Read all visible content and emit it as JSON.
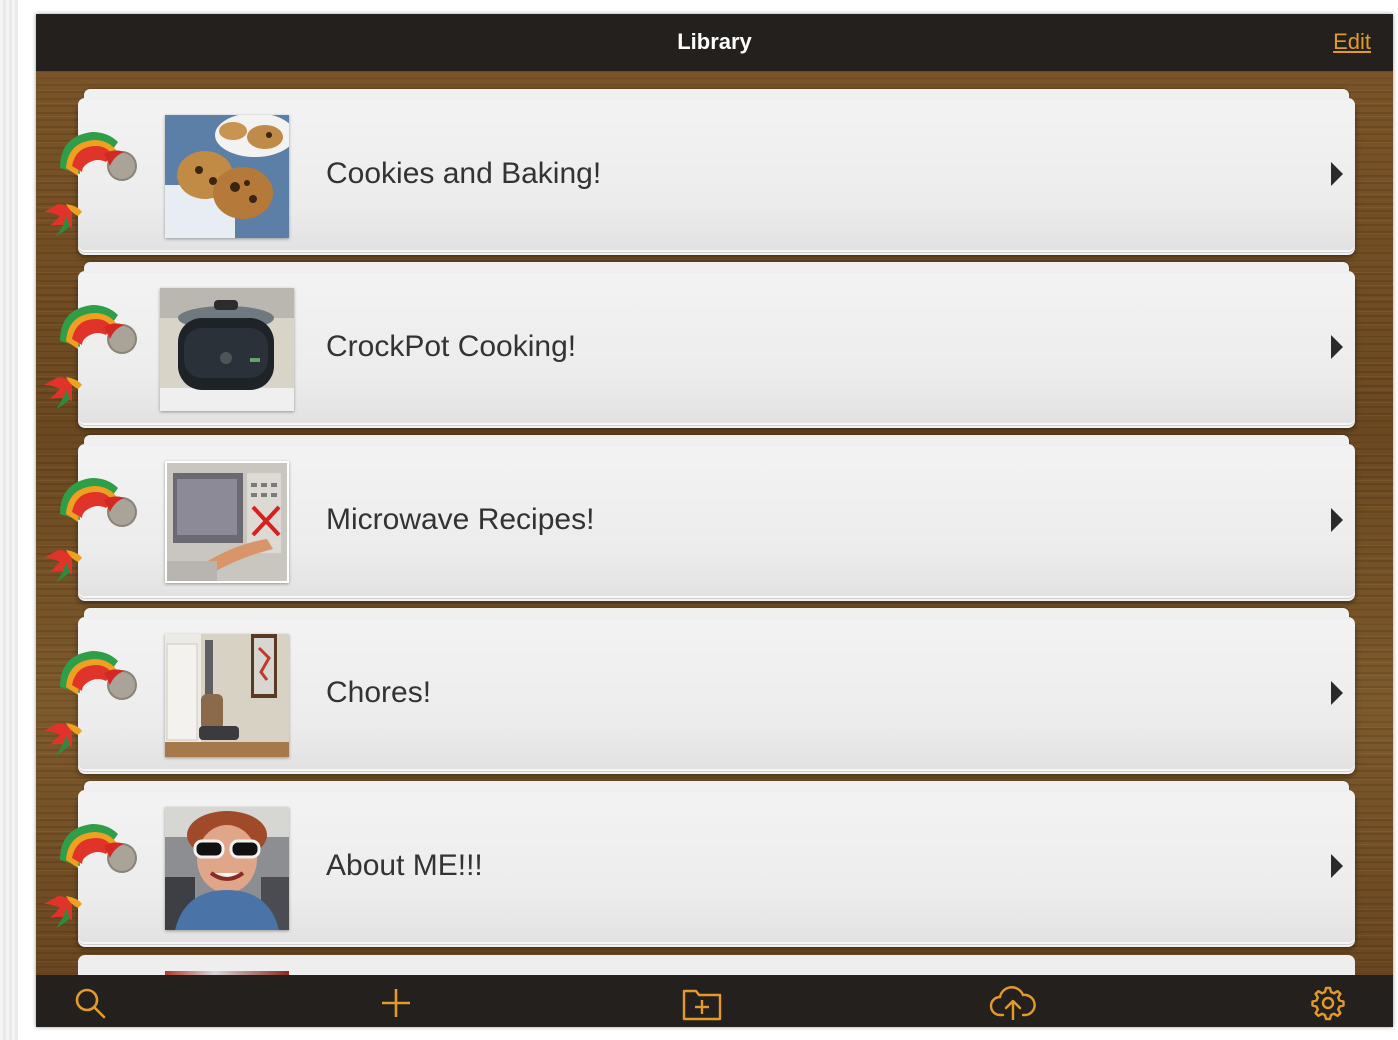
{
  "navbar": {
    "title": "Library",
    "edit_label": "Edit"
  },
  "rows": [
    {
      "label": "Cookies and Baking!",
      "thumb_icon": "cookies-photo"
    },
    {
      "label": "CrockPot Cooking!",
      "thumb_icon": "crockpot-photo"
    },
    {
      "label": "Microwave Recipes!",
      "thumb_icon": "microwave-photo"
    },
    {
      "label": "Chores!",
      "thumb_icon": "vacuum-photo"
    },
    {
      "label": "About ME!!!",
      "thumb_icon": "portrait-photo"
    }
  ],
  "tabbar": {
    "icons": [
      "search-icon",
      "add-icon",
      "add-folder-icon",
      "cloud-upload-icon",
      "settings-icon"
    ]
  },
  "colors": {
    "accent": "#e39a2d",
    "bar": "#24201d",
    "card": "#eeeeee",
    "text": "#333333"
  }
}
